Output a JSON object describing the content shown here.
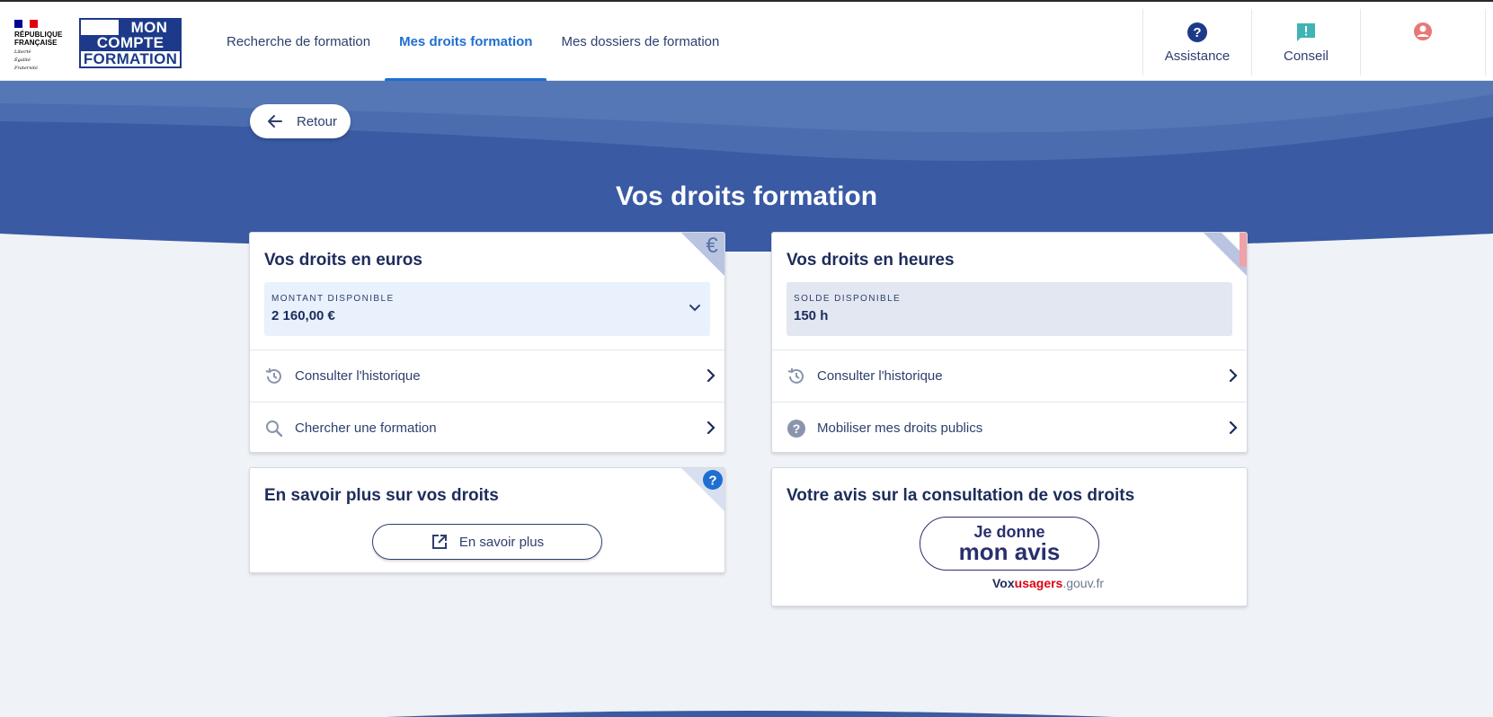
{
  "header": {
    "republic_lines": [
      "RÉPUBLIQUE",
      "FRANÇAISE"
    ],
    "motto_lines": [
      "Liberté",
      "Égalité",
      "Fraternité"
    ],
    "logo_lines": [
      "MON",
      "COMPTE",
      "FORMATION"
    ],
    "nav": [
      {
        "label": "Recherche de formation",
        "active": false
      },
      {
        "label": "Mes droits formation",
        "active": true
      },
      {
        "label": "Mes dossiers de formation",
        "active": false
      }
    ],
    "tools": {
      "assistance": "Assistance",
      "conseil": "Conseil"
    }
  },
  "back_label": "Retour",
  "page_title": "Vos droits formation",
  "card_euros": {
    "title": "Vos droits en euros",
    "amount_label": "MONTANT DISPONIBLE",
    "amount_value": "2 160,00 €",
    "rows": [
      "Consulter l'historique",
      "Chercher une formation"
    ]
  },
  "card_hours": {
    "title": "Vos droits en heures",
    "balance_label": "SOLDE DISPONIBLE",
    "balance_value": "150 h",
    "rows": [
      "Consulter l'historique",
      "Mobiliser mes droits publics"
    ]
  },
  "card_info": {
    "title": "En savoir plus sur vos droits",
    "button_label": "En savoir plus"
  },
  "card_avis": {
    "title": "Votre avis sur la consultation de vos droits",
    "button_line1": "Je donne",
    "button_line2": "mon avis",
    "vox_parts": [
      "Vox",
      "usagers",
      ".gouv.fr"
    ]
  },
  "colors": {
    "brand_blue": "#1d3a8a",
    "banner_blue": "#3a5aa4",
    "active_link": "#1e6fd0",
    "amount_bg": "#e8f1fc",
    "balance_bg": "#e3e7f1",
    "avatar": "#e87878",
    "conseil_icon": "#3fb4b4"
  }
}
